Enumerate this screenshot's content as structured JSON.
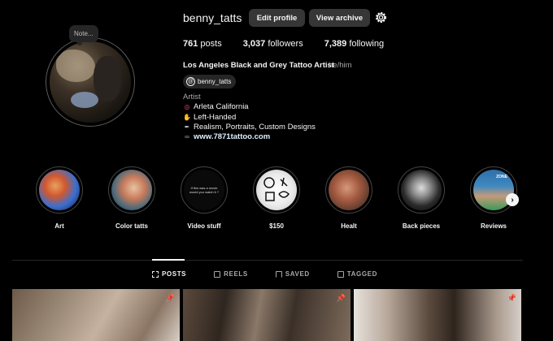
{
  "profile": {
    "username": "benny_tatts",
    "note": "Note...",
    "edit_label": "Edit profile",
    "archive_label": "View archive",
    "settings_icon": "gear-icon"
  },
  "stats": {
    "posts_count": "761",
    "posts_label": "posts",
    "followers_count": "3,037",
    "followers_label": "followers",
    "following_count": "7,389",
    "following_label": "following"
  },
  "bio": {
    "name": "Los Angeles Black and Grey Tattoo Artist",
    "pronouns": "he/him",
    "threads_handle": "benny_tatts",
    "category": "Artist",
    "lines": [
      {
        "icon": "pin-icon",
        "text": "Arleta California"
      },
      {
        "icon": "hand-icon",
        "text": "Left-Handed"
      },
      {
        "icon": "needle-icon",
        "text": "Realism, Portraits, Custom Designs"
      }
    ],
    "link": "www.7871tattoo.com"
  },
  "highlights": [
    {
      "label": "Art"
    },
    {
      "label": "Color tatts"
    },
    {
      "label": "Video stuff",
      "cover_text": "If this was a movie would you watch it ?"
    },
    {
      "label": "$150"
    },
    {
      "label": "Healt"
    },
    {
      "label": "Back pieces"
    },
    {
      "label": "Reviews",
      "cover_text": "ZONE"
    }
  ],
  "tabs": [
    {
      "label": "POSTS",
      "active": true
    },
    {
      "label": "REELS",
      "active": false
    },
    {
      "label": "SAVED",
      "active": false
    },
    {
      "label": "TAGGED",
      "active": false
    }
  ],
  "colors": {
    "background": "#000000",
    "button": "#363636",
    "secondary_text": "#a8a8a8"
  }
}
